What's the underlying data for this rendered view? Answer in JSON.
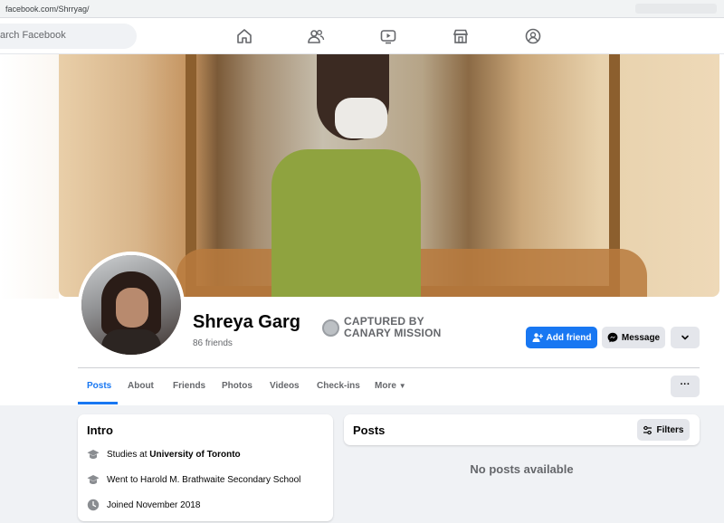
{
  "browser": {
    "url": "facebook.com/Shrryag/"
  },
  "topnav": {
    "search_placeholder": "arch Facebook",
    "icons": [
      "home-icon",
      "friends-icon",
      "watch-icon",
      "marketplace-icon",
      "groups-icon"
    ]
  },
  "profile": {
    "name": "Shreya Garg",
    "friends": "86 friends",
    "badge_line1": "CAPTURED BY",
    "badge_line2": "CANARY MISSION"
  },
  "actions": {
    "add_friend": "Add friend",
    "message": "Message"
  },
  "tabs": [
    {
      "label": "Posts",
      "active": true
    },
    {
      "label": "About"
    },
    {
      "label": "Friends"
    },
    {
      "label": "Photos"
    },
    {
      "label": "Videos"
    },
    {
      "label": "Check-ins"
    },
    {
      "label": "More"
    }
  ],
  "intro": {
    "title": "Intro",
    "study_prefix": "Studies at ",
    "study_school": "University of Toronto",
    "went_to": "Went to Harold M. Brathwaite Secondary School",
    "joined": "Joined November 2018"
  },
  "posts": {
    "title": "Posts",
    "filters": "Filters",
    "empty": "No posts available"
  },
  "colors": {
    "accent": "#1877f2",
    "page_bg": "#f0f2f5",
    "secondary_text": "#65676b"
  }
}
